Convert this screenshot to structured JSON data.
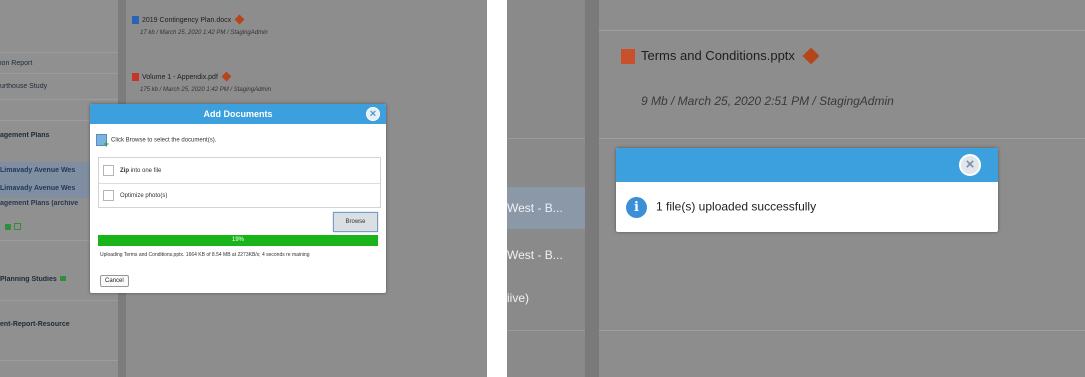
{
  "left": {
    "sidebar": {
      "items": [
        {
          "label": "ion Report"
        },
        {
          "label": "urthouse Study"
        },
        {
          "label": "agement Plans"
        },
        {
          "label": "Limavady Avenue Wes"
        },
        {
          "label": "Limavady Avenue Wes"
        },
        {
          "label": "agement Plans (archive"
        },
        {
          "label": "Planning Studies"
        },
        {
          "label": "ent-Report-Resource"
        }
      ]
    },
    "documents": [
      {
        "name": "2019 Contingency Plan.docx",
        "meta": "17 kb / March 25, 2020 1:42 PM / StagingAdmin"
      },
      {
        "name": "Volume 1 - Appendix.pdf",
        "meta": "175 kb / March 25, 2020 1:42 PM / StagingAdmin"
      }
    ],
    "dialog": {
      "title": "Add Documents",
      "instruction": "Click Browse to select the document(s).",
      "zip_bold": "Zip",
      "zip_rest": " into one file",
      "optimize": "Optimize photo(s)",
      "browse": "Browse",
      "progress_label": "19%",
      "progress_value": 0.19,
      "status": "Uploading Terms and Conditions.pptx. 1664 KB of 8.54 MB at 2273KB/s; 4 seconds re maining",
      "cancel": "Cancel"
    }
  },
  "right": {
    "sidebar": {
      "items": [
        {
          "label": "West - B..."
        },
        {
          "label": "West - B..."
        },
        {
          "label": "iive)"
        }
      ]
    },
    "file": {
      "name": "Terms and Conditions.pptx",
      "meta": "9 Mb / March 25, 2020 2:51 PM / StagingAdmin"
    },
    "alert": {
      "message": "1 file(s) uploaded successfully"
    }
  },
  "colors": {
    "accent": "#3ba0dd",
    "progress": "#19b419",
    "warning": "#b5461c",
    "overlay": "#8b8b8b"
  },
  "icons": [
    "word-doc-icon",
    "pdf-doc-icon",
    "warning-diamond-icon",
    "close-icon",
    "add-document-icon",
    "info-icon",
    "powerpoint-doc-icon"
  ]
}
